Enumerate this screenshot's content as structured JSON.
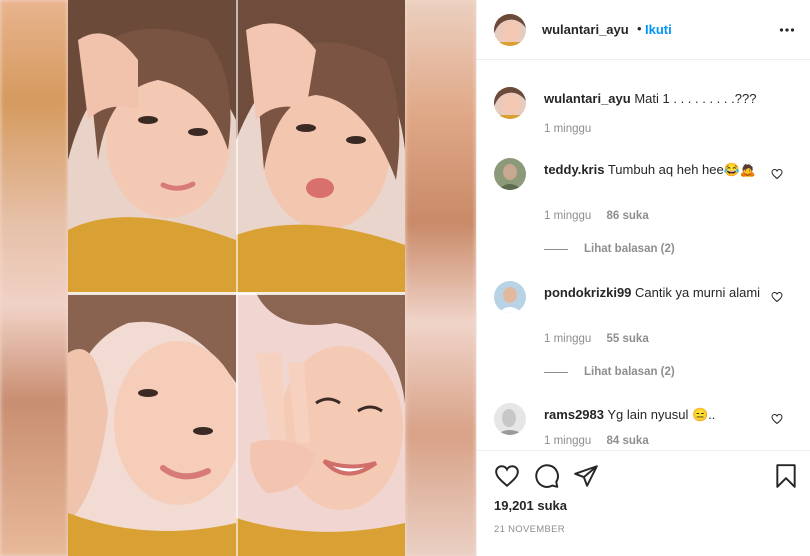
{
  "post": {
    "author": "wulantari_ayu",
    "dot": "•",
    "follow_label": "Ikuti",
    "likes_total": "19,201 suka",
    "date": "21 NOVEMBER"
  },
  "comments": [
    {
      "user": "wulantari_ayu",
      "text": "Mati 1 . . . . . . . . .???",
      "time": "1 minggu",
      "likes": "",
      "reply": "",
      "view_replies": "",
      "likeable": false
    },
    {
      "user": "teddy.kris",
      "text": "Tumbuh aq heh hee😂🙇",
      "time": "1 minggu",
      "likes": "86 suka",
      "reply": "",
      "view_replies": "Lihat balasan (2)",
      "likeable": true
    },
    {
      "user": "pondokrizki99",
      "text": "Cantik ya murni alami",
      "time": "1 minggu",
      "likes": "55 suka",
      "reply": "",
      "view_replies": "Lihat balasan (2)",
      "likeable": true
    },
    {
      "user": "rams2983",
      "text": "Yg lain nyusul 😑..",
      "time": "1 minggu",
      "likes": "84 suka",
      "reply": "",
      "view_replies": "",
      "likeable": true
    }
  ],
  "icons": {
    "more": "more-horizontal-icon",
    "like": "heart-icon",
    "comment": "comment-icon",
    "share": "share-icon",
    "save": "bookmark-icon"
  },
  "colors": {
    "link": "#0095f6",
    "muted": "#8e8e8e",
    "text": "#262626"
  }
}
